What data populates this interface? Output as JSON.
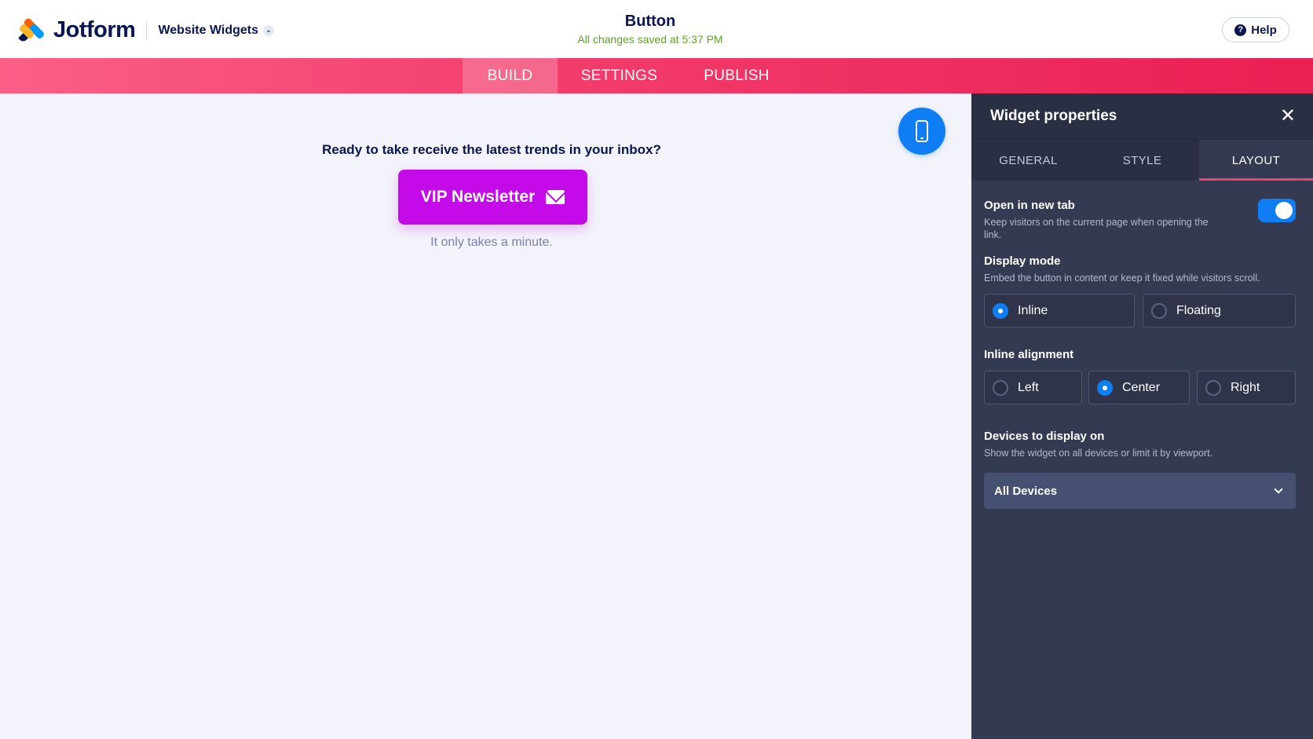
{
  "header": {
    "brand": "Jotform",
    "workspace_menu": "Website Widgets",
    "doc_title": "Button",
    "save_status": "All changes saved at 5:37 PM",
    "help_label": "Help"
  },
  "nav": {
    "tabs": [
      {
        "label": "BUILD",
        "active": true
      },
      {
        "label": "SETTINGS",
        "active": false
      },
      {
        "label": "PUBLISH",
        "active": false
      }
    ]
  },
  "canvas": {
    "device_toggle_icon": "mobile-phone-icon",
    "widget_heading": "Ready to take receive the latest trends in your inbox?",
    "button_label": "VIP Newsletter",
    "button_icon": "envelope-icon",
    "button_color": "#c40ae8",
    "subtext": "It only takes a minute."
  },
  "panel": {
    "title": "Widget properties",
    "tabs": [
      {
        "label": "GENERAL",
        "active": false
      },
      {
        "label": "STYLE",
        "active": false
      },
      {
        "label": "LAYOUT",
        "active": true
      }
    ],
    "open_new_tab": {
      "label": "Open in new tab",
      "description": "Keep visitors on the current page when opening the link.",
      "enabled": true
    },
    "display_mode": {
      "label": "Display mode",
      "description": "Embed the button in content or keep it fixed while visitors scroll.",
      "options": [
        {
          "label": "Inline",
          "selected": true
        },
        {
          "label": "Floating",
          "selected": false
        }
      ]
    },
    "inline_alignment": {
      "label": "Inline alignment",
      "options": [
        {
          "label": "Left",
          "selected": false
        },
        {
          "label": "Center",
          "selected": true
        },
        {
          "label": "Right",
          "selected": false
        }
      ]
    },
    "devices": {
      "label": "Devices to display on",
      "description": "Show the widget on all devices or limit it by viewport.",
      "selected": "All Devices"
    }
  },
  "colors": {
    "accent_pink": "#f33e6e",
    "accent_blue": "#0f7ef5",
    "save_green": "#5fa22c",
    "panel_bg": "#343a52",
    "brand_navy": "#0a1551"
  }
}
